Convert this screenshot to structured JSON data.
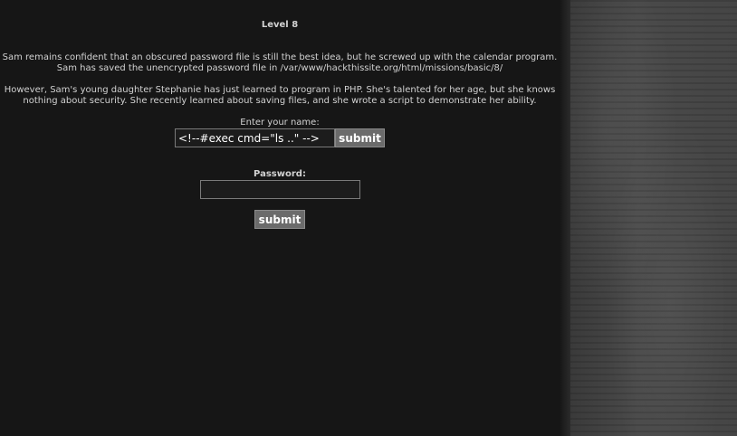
{
  "mission": {
    "title": "Level 8",
    "paragraph1": "Sam remains confident that an obscured password file is still the best idea, but he screwed up with the calendar program. Sam has saved the unencrypted password file in /var/www/hackthissite.org/html/missions/basic/8/",
    "paragraph2": "However, Sam's young daughter Stephanie has just learned to program in PHP. She's talented for her age, but she knows nothing about security. She recently learned about saving files, and she wrote a script to demonstrate her ability."
  },
  "name_form": {
    "label": "Enter your name:",
    "input_value": "<!--#exec cmd=\"ls ..\" -->",
    "submit_label": "submit"
  },
  "password_form": {
    "label": "Password:",
    "input_value": "",
    "submit_label": "submit"
  },
  "colors": {
    "background": "#161616",
    "button": "#6b6b6b",
    "text": "#d2d2d2"
  }
}
